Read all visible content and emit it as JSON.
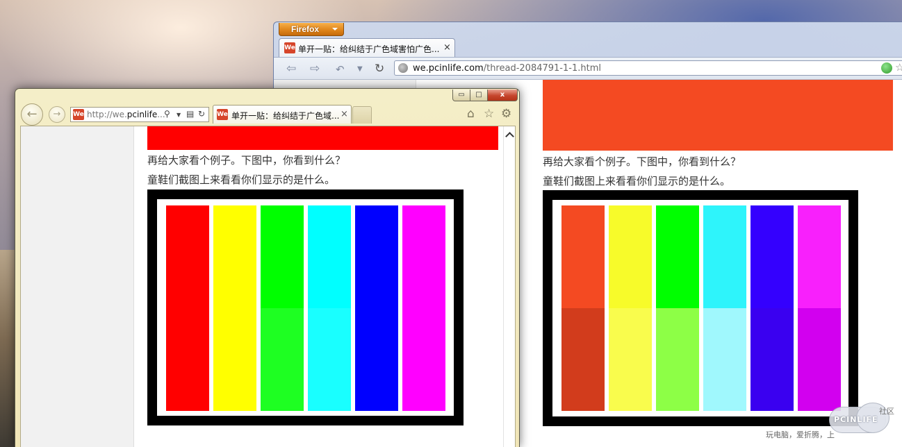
{
  "firefox": {
    "menu_label": "Firefox",
    "tab_title": "单开一贴：给纠结于广色域害怕广色...",
    "tab_close": "×",
    "url_domain": "we.pcinlife.com",
    "url_path": "/thread-2084791-1-1.html"
  },
  "ie": {
    "address_prefix": "http://we.",
    "address_domain": "pcinlife",
    "address_suffix": "...",
    "tab_title": "单开一贴：给纠结于广色域...",
    "tab_close": "×",
    "window_buttons": {
      "minimize": "▭",
      "maximize": "□",
      "close": "x"
    }
  },
  "favicon_label": "We",
  "post": {
    "line1": "再给大家看个例子。下图中，你看到什么？",
    "line2": "童鞋们截图上来看看你们显示的是什么。"
  },
  "ie_bars": [
    {
      "name": "red",
      "top": "#ff0000",
      "bottom": "#ff0000"
    },
    {
      "name": "yellow",
      "top": "#ffff00",
      "bottom": "#ffff00"
    },
    {
      "name": "green",
      "top": "#00ff00",
      "bottom": "#1eff22"
    },
    {
      "name": "cyan",
      "top": "#00ffff",
      "bottom": "#19ffff"
    },
    {
      "name": "blue",
      "top": "#0000ff",
      "bottom": "#0000ff"
    },
    {
      "name": "magenta",
      "top": "#ff00ff",
      "bottom": "#ff00ff"
    }
  ],
  "ff_bars": [
    {
      "name": "red",
      "top": "#f44a22",
      "bottom": "#d23c1c"
    },
    {
      "name": "yellow",
      "top": "#f7fb2a",
      "bottom": "#f9fc4d"
    },
    {
      "name": "green",
      "top": "#00ff00",
      "bottom": "#8dff46"
    },
    {
      "name": "cyan",
      "top": "#2ef4fb",
      "bottom": "#a0f8fd"
    },
    {
      "name": "blue",
      "top": "#3400fe",
      "bottom": "#3a00f0"
    },
    {
      "name": "magenta",
      "top": "#f820fc",
      "bottom": "#d200ef"
    }
  ],
  "ie_red_header": "#ff0000",
  "ff_red_header": "#f44a22",
  "watermark": {
    "logo": "PCINLIFE",
    "community": "社区",
    "slogan": "玩电脑，爱折腾，上"
  }
}
